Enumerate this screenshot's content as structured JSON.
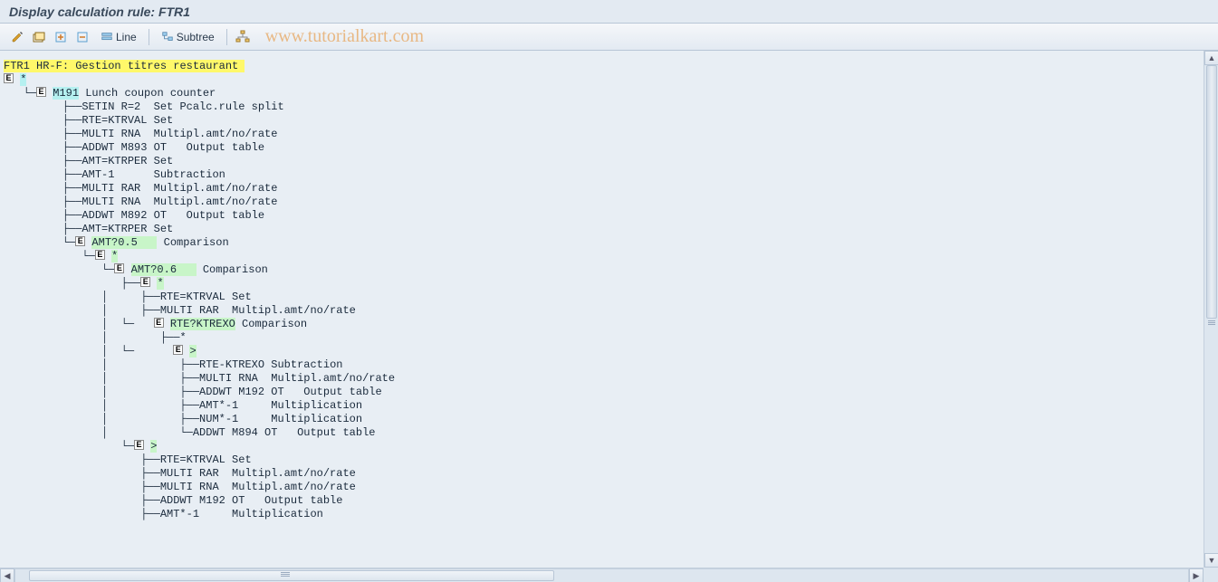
{
  "title": "Display calculation rule: FTR1",
  "toolbar": {
    "line_label": "Line",
    "subtree_label": "Subtree"
  },
  "watermark": "www.tutorialkart.com",
  "tree": {
    "root_code": "FTR1",
    "root_text": " HR-F: Gestion titres restaurant ",
    "lines": [
      {
        "indent": 0,
        "expander": true,
        "code": "*",
        "hl": "cyan"
      },
      {
        "indent": 1,
        "lshape": true,
        "expander": true,
        "code": "M191",
        "hl": "cyan",
        "text": " Lunch coupon counter"
      },
      {
        "indent": 3,
        "tee": true,
        "plain": "SETIN R=2  Set Pcalc.rule split"
      },
      {
        "indent": 3,
        "tee": true,
        "plain": "RTE=KTRVAL Set"
      },
      {
        "indent": 3,
        "tee": true,
        "plain": "MULTI RNA  Multipl.amt/no/rate"
      },
      {
        "indent": 3,
        "tee": true,
        "plain": "ADDWT M893 OT   Output table"
      },
      {
        "indent": 3,
        "tee": true,
        "plain": "AMT=KTRPER Set"
      },
      {
        "indent": 3,
        "tee": true,
        "plain": "AMT-1      Subtraction"
      },
      {
        "indent": 3,
        "tee": true,
        "plain": "MULTI RAR  Multipl.amt/no/rate"
      },
      {
        "indent": 3,
        "tee": true,
        "plain": "MULTI RNA  Multipl.amt/no/rate"
      },
      {
        "indent": 3,
        "tee": true,
        "plain": "ADDWT M892 OT   Output table"
      },
      {
        "indent": 3,
        "tee": true,
        "plain": "AMT=KTRPER Set"
      },
      {
        "indent": 3,
        "lshape": true,
        "expander": true,
        "code": "AMT?0.5   ",
        "hl": "green",
        "text": " Comparison"
      },
      {
        "indent": 4,
        "lshape": true,
        "expander": true,
        "code": "*",
        "hl": "green"
      },
      {
        "indent": 5,
        "lshape": true,
        "expander": true,
        "code": "AMT?0.6   ",
        "hl": "green",
        "text": " Comparison"
      },
      {
        "indent": 6,
        "tee": true,
        "expander": true,
        "code": "*",
        "hl": "green"
      },
      {
        "indent": 6,
        "bar": true,
        "indent2": 1,
        "tee2": true,
        "plain": "RTE=KTRVAL Set"
      },
      {
        "indent": 6,
        "bar": true,
        "indent2": 1,
        "tee2": true,
        "plain": "MULTI RAR  Multipl.amt/no/rate"
      },
      {
        "indent": 6,
        "bar": true,
        "indent2": 1,
        "lshape": true,
        "expander": true,
        "code": "RTE?KTREXO",
        "hl": "green",
        "text": " Comparison"
      },
      {
        "indent": 6,
        "bar": true,
        "indent2": 2,
        "tee2": true,
        "plain": "*"
      },
      {
        "indent": 6,
        "bar": true,
        "indent2": 2,
        "lshape": true,
        "expander": true,
        "code": ">",
        "hl": "green"
      },
      {
        "indent": 6,
        "bar": true,
        "indent2": 3,
        "tee2": true,
        "plain": "RTE-KTREXO Subtraction"
      },
      {
        "indent": 6,
        "bar": true,
        "indent2": 3,
        "tee2": true,
        "plain": "MULTI RNA  Multipl.amt/no/rate"
      },
      {
        "indent": 6,
        "bar": true,
        "indent2": 3,
        "tee2": true,
        "plain": "ADDWT M192 OT   Output table"
      },
      {
        "indent": 6,
        "bar": true,
        "indent2": 3,
        "tee2": true,
        "plain": "AMT*-1     Multiplication"
      },
      {
        "indent": 6,
        "bar": true,
        "indent2": 3,
        "tee2": true,
        "plain": "NUM*-1     Multiplication"
      },
      {
        "indent": 6,
        "bar": true,
        "indent2": 3,
        "lshape2": true,
        "plain": "ADDWT M894 OT   Output table"
      },
      {
        "indent": 6,
        "lshape": true,
        "expander": true,
        "code": ">",
        "hl": "green"
      },
      {
        "indent": 7,
        "tee": true,
        "plain": "RTE=KTRVAL Set"
      },
      {
        "indent": 7,
        "tee": true,
        "plain": "MULTI RAR  Multipl.amt/no/rate"
      },
      {
        "indent": 7,
        "tee": true,
        "plain": "MULTI RNA  Multipl.amt/no/rate"
      },
      {
        "indent": 7,
        "tee": true,
        "plain": "ADDWT M192 OT   Output table"
      },
      {
        "indent": 7,
        "tee": true,
        "plain": "AMT*-1     Multiplication"
      }
    ]
  }
}
